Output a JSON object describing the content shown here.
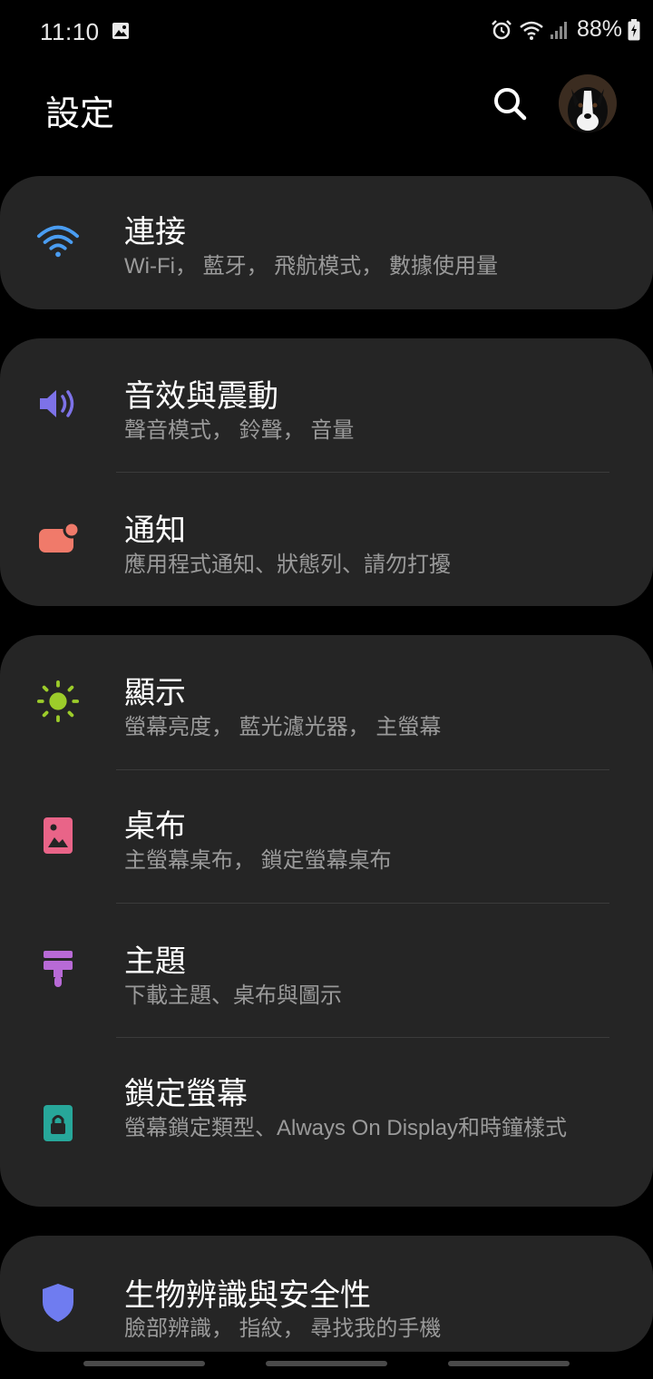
{
  "status_bar": {
    "time": "11:10",
    "battery": "88%",
    "icons": [
      "gallery-icon",
      "alarm-icon",
      "wifi-icon",
      "signal-icon",
      "battery-charging-icon"
    ]
  },
  "header": {
    "title": "設定",
    "search_icon": "search-icon",
    "avatar": "profile-avatar"
  },
  "settings": [
    {
      "title": "連接",
      "subtitle": "Wi-Fi， 藍牙， 飛航模式， 數據使用量",
      "icon": "wifi-icon",
      "color": "#4a9df2"
    },
    {
      "title": "音效與震動",
      "subtitle": "聲音模式， 鈴聲， 音量",
      "icon": "volume-icon",
      "color": "#7d72e8"
    },
    {
      "title": "通知",
      "subtitle": "應用程式通知、狀態列、請勿打擾",
      "icon": "notification-icon",
      "color": "#f07a6a"
    },
    {
      "title": "顯示",
      "subtitle": "螢幕亮度， 藍光濾光器， 主螢幕",
      "icon": "brightness-icon",
      "color": "#9ccc2a"
    },
    {
      "title": "桌布",
      "subtitle": "主螢幕桌布， 鎖定螢幕桌布",
      "icon": "wallpaper-icon",
      "color": "#e96488"
    },
    {
      "title": "主題",
      "subtitle": "下載主題、桌布與圖示",
      "icon": "theme-brush-icon",
      "color": "#b86ad6"
    },
    {
      "title": "鎖定螢幕",
      "subtitle": "螢幕鎖定類型、Always On Display和時鐘樣式",
      "icon": "lock-icon",
      "color": "#27a79a"
    },
    {
      "title": "生物辨識與安全性",
      "subtitle": "臉部辨識， 指紋， 尋找我的手機",
      "icon": "shield-icon",
      "color": "#6f7cf0"
    }
  ],
  "colors": {
    "background": "#000000",
    "card": "#252525",
    "subtitle": "#9a9a9a"
  }
}
